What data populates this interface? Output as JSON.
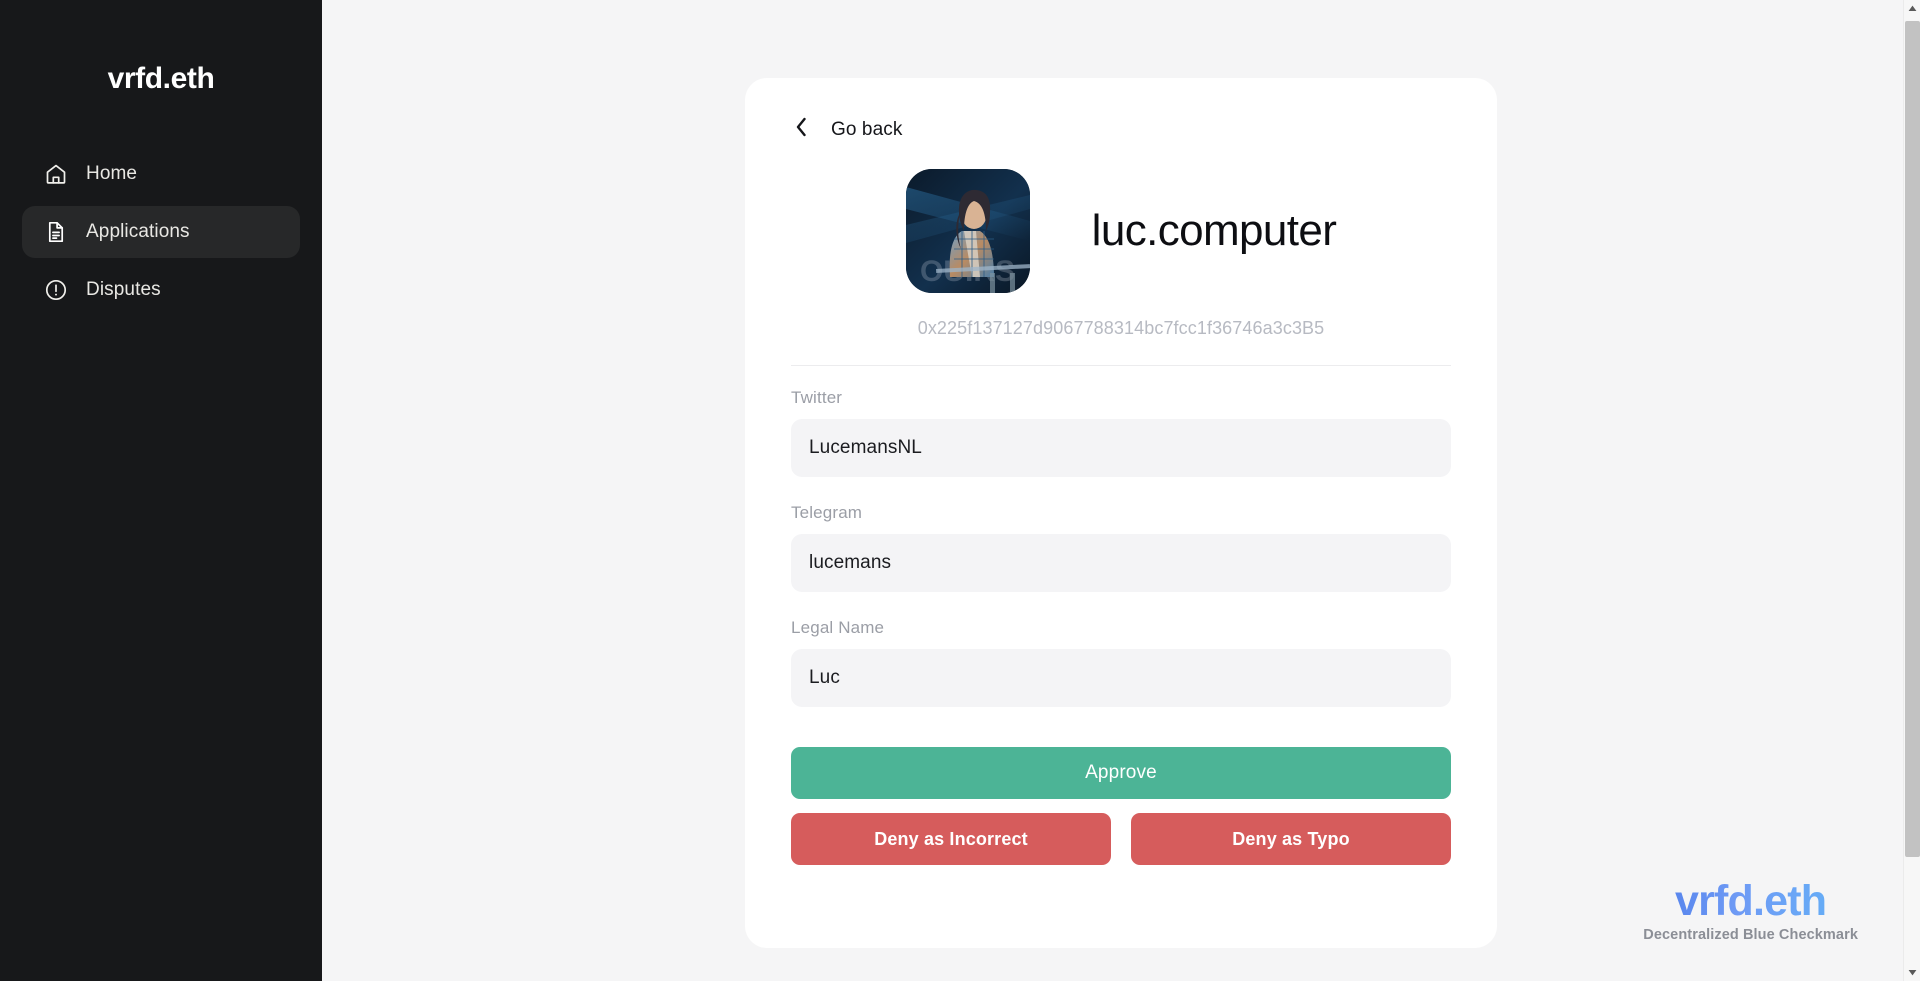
{
  "sidebar": {
    "brand": "vrfd.eth",
    "items": [
      {
        "label": "Home",
        "icon": "house-icon",
        "active": false
      },
      {
        "label": "Applications",
        "icon": "document-icon",
        "active": true
      },
      {
        "label": "Disputes",
        "icon": "exclamation-circle-icon",
        "active": false
      }
    ]
  },
  "card": {
    "back_label": "Go back",
    "profile_name": "luc.computer",
    "address": "0x225f137127d9067788314bc7fcc1f36746a3c3B5",
    "fields": [
      {
        "label": "Twitter",
        "value": "LucemansNL"
      },
      {
        "label": "Telegram",
        "value": "lucemans"
      },
      {
        "label": "Legal Name",
        "value": "Luc"
      }
    ],
    "actions": {
      "approve": "Approve",
      "deny_incorrect": "Deny as Incorrect",
      "deny_typo": "Deny as Typo"
    }
  },
  "watermark": {
    "logo": "vrfd.eth",
    "tagline": "Decentralized Blue Checkmark"
  },
  "colors": {
    "sidebar_bg": "#17181a",
    "sidebar_active": "#272829",
    "page_bg": "#f5f5f6",
    "card_bg": "#ffffff",
    "approve_green": "#4cb496",
    "deny_red": "#d65c5c",
    "field_bg": "#f4f4f6",
    "address_gray": "#b7bac2",
    "watermark_blue": "#4f7dea"
  }
}
